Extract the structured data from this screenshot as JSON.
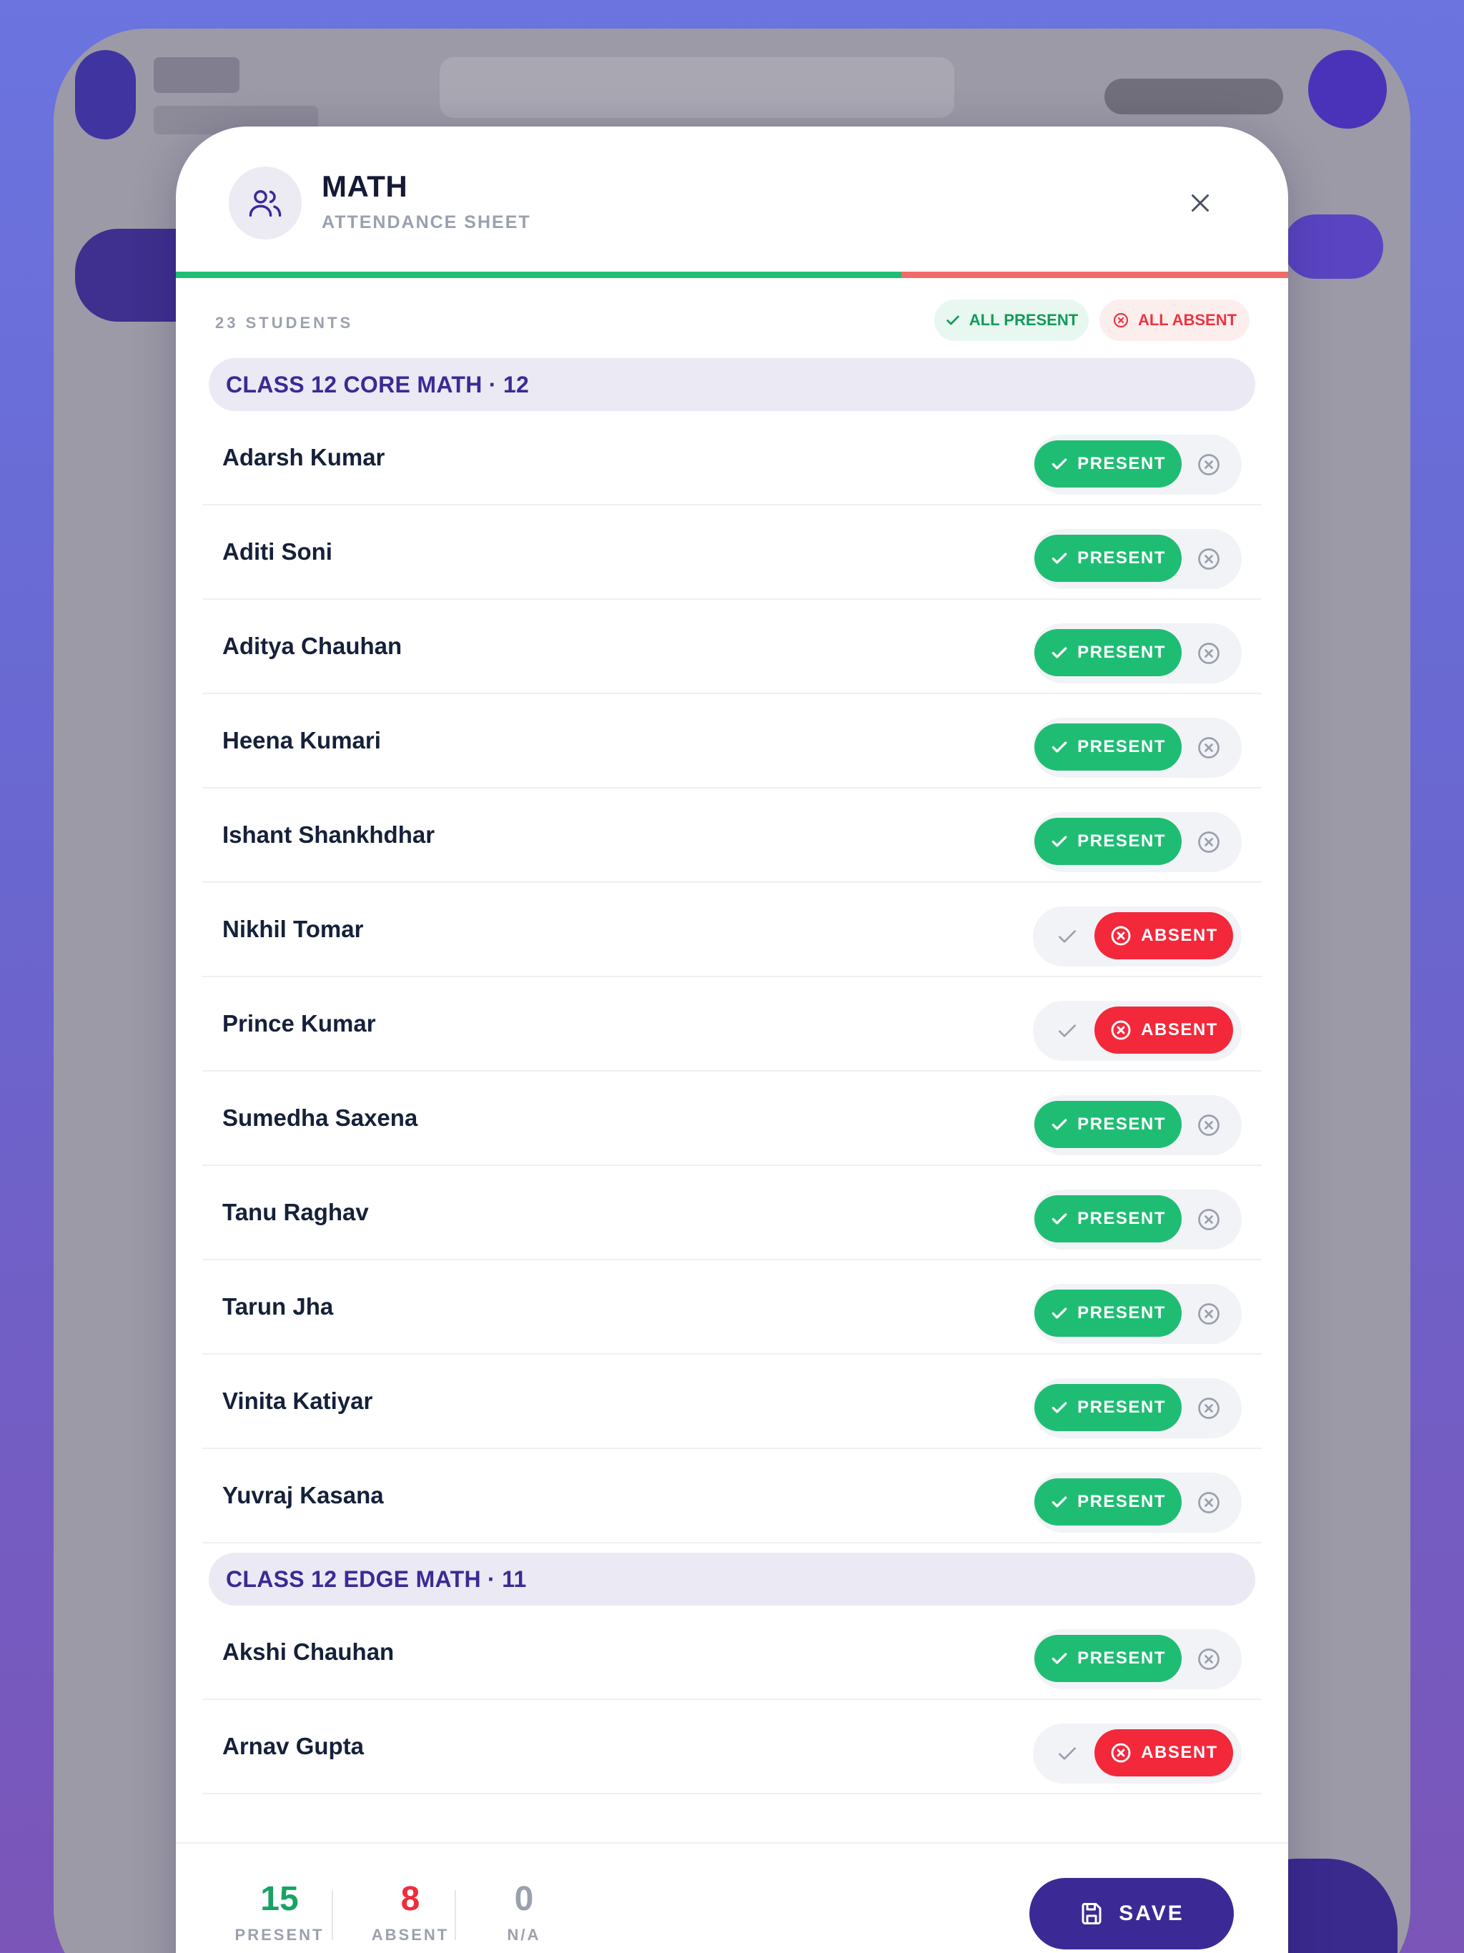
{
  "modal": {
    "title": "MATH",
    "subtitle": "ATTENDANCE SHEET",
    "close_icon": "close-icon"
  },
  "toolbar": {
    "student_count": "23 STUDENTS",
    "all_present_label": "ALL PRESENT",
    "all_absent_label": "ALL ABSENT"
  },
  "ratio": {
    "present": 15,
    "absent": 8
  },
  "labels": {
    "present": "PRESENT",
    "absent": "ABSENT"
  },
  "groups": [
    {
      "title": "CLASS 12 CORE MATH · 12",
      "students": [
        {
          "name": "Adarsh Kumar",
          "status": "present"
        },
        {
          "name": "Aditi Soni",
          "status": "present"
        },
        {
          "name": "Aditya Chauhan",
          "status": "present"
        },
        {
          "name": "Heena Kumari",
          "status": "present"
        },
        {
          "name": "Ishant Shankhdhar",
          "status": "present"
        },
        {
          "name": "Nikhil Tomar",
          "status": "absent"
        },
        {
          "name": "Prince Kumar",
          "status": "absent"
        },
        {
          "name": "Sumedha Saxena",
          "status": "present"
        },
        {
          "name": "Tanu Raghav",
          "status": "present"
        },
        {
          "name": "Tarun Jha",
          "status": "present"
        },
        {
          "name": "Vinita Katiyar",
          "status": "present"
        },
        {
          "name": "Yuvraj Kasana",
          "status": "present"
        }
      ]
    },
    {
      "title": "CLASS 12 EDGE MATH · 11",
      "students": [
        {
          "name": "Akshi Chauhan",
          "status": "present"
        },
        {
          "name": "Arnav Gupta",
          "status": "absent"
        }
      ]
    }
  ],
  "footer": {
    "present_count": "15",
    "present_label": "PRESENT",
    "absent_count": "8",
    "absent_label": "ABSENT",
    "na_count": "0",
    "na_label": "N/A",
    "save_label": "SAVE"
  },
  "colors": {
    "present": "#1fbd74",
    "absent": "#f3283a",
    "accent": "#3b2a95"
  }
}
